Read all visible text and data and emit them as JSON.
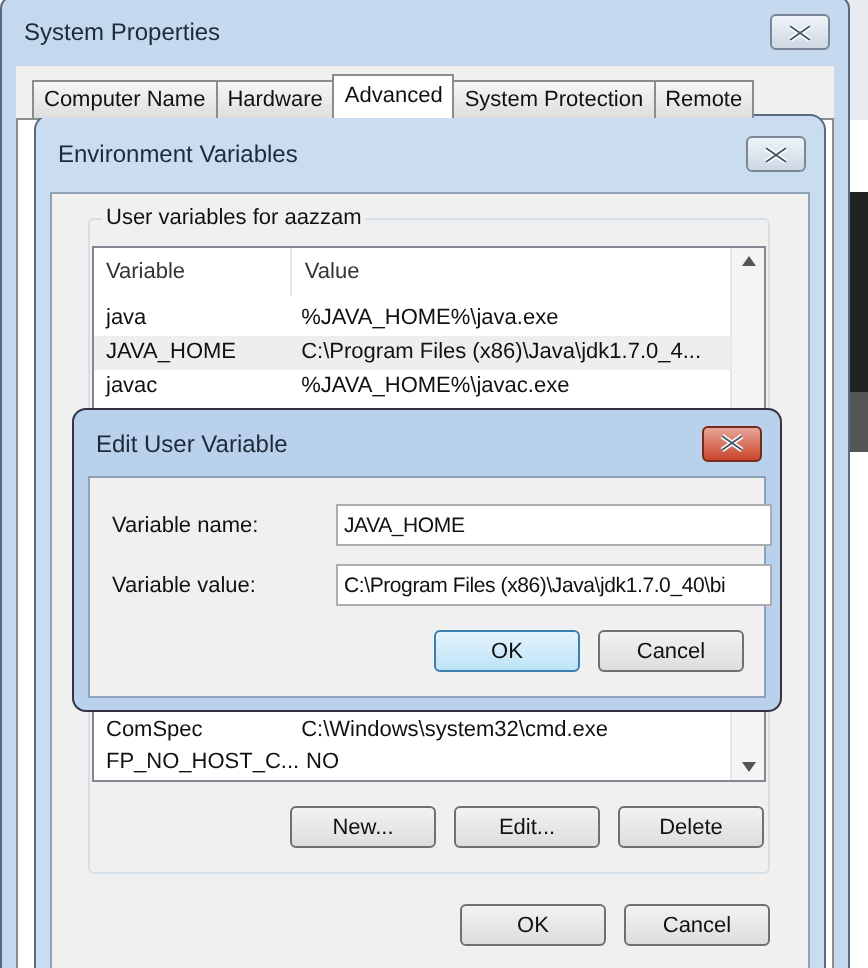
{
  "system_properties": {
    "title": "System Properties",
    "tabs": [
      {
        "label": "Computer Name",
        "selected": false
      },
      {
        "label": "Hardware",
        "selected": false
      },
      {
        "label": "Advanced",
        "selected": true
      },
      {
        "label": "System Protection",
        "selected": false
      },
      {
        "label": "Remote",
        "selected": false
      }
    ]
  },
  "environment_variables": {
    "title": "Environment Variables",
    "group_label": "User variables for aazzam",
    "columns": [
      "Variable",
      "Value"
    ],
    "rows": [
      {
        "variable": "java",
        "value": "%JAVA_HOME%\\java.exe",
        "selected": false
      },
      {
        "variable": "JAVA_HOME",
        "value": "C:\\Program Files (x86)\\Java\\jdk1.7.0_4...",
        "selected": true
      },
      {
        "variable": "javac",
        "value": "%JAVA_HOME%\\javac.exe",
        "selected": false
      }
    ],
    "rows_below_dialog": [
      {
        "variable": "ComSpec",
        "value": "C:\\Windows\\system32\\cmd.exe",
        "selected": false
      },
      {
        "variable": "FP_NO_HOST_C...",
        "value": "NO",
        "selected": false
      }
    ],
    "list_buttons": [
      "New...",
      "Edit...",
      "Delete"
    ],
    "dialog_buttons": [
      "OK",
      "Cancel"
    ]
  },
  "edit_dialog": {
    "title": "Edit User Variable",
    "fields": [
      {
        "label": "Variable name:",
        "value": "JAVA_HOME"
      },
      {
        "label": "Variable value:",
        "value": "C:\\Program Files (x86)\\Java\\jdk1.7.0_40\\bi"
      }
    ],
    "buttons": [
      {
        "label": "OK",
        "default": true
      },
      {
        "label": "Cancel",
        "default": false
      }
    ]
  }
}
